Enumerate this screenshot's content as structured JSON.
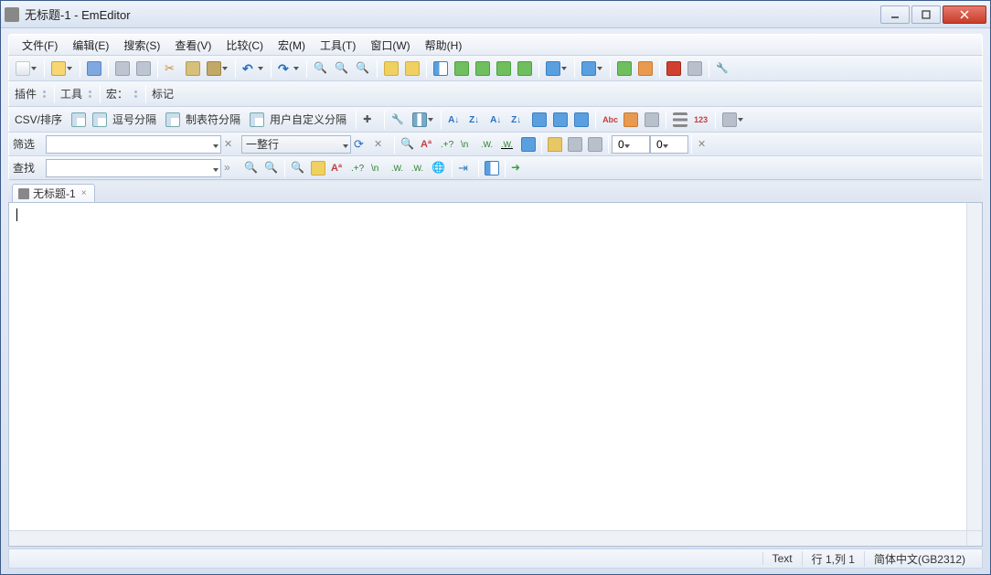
{
  "window": {
    "title": "无标题-1 - EmEditor"
  },
  "menu": {
    "file": "文件(F)",
    "edit": "编辑(E)",
    "search": "搜索(S)",
    "view": "查看(V)",
    "compare": "比较(C)",
    "macro": "宏(M)",
    "tools": "工具(T)",
    "window": "窗口(W)",
    "help": "帮助(H)"
  },
  "plugin_bar": {
    "plugins": "插件",
    "tools": "工具",
    "macros": "宏：",
    "markers": "标记"
  },
  "csv_bar": {
    "label": "CSV/排序",
    "comma": "逗号分隔",
    "tab": "制表符分隔",
    "user": "用户自定义分隔"
  },
  "filter_row": {
    "label": "筛选",
    "column_select": "一整行",
    "spin1": "0",
    "spin2": "0"
  },
  "find_row": {
    "label": "查找"
  },
  "tab": {
    "name": "无标题-1"
  },
  "status": {
    "mode": "Text",
    "pos": "行 1,列 1",
    "encoding": "简体中文(GB2312)"
  }
}
